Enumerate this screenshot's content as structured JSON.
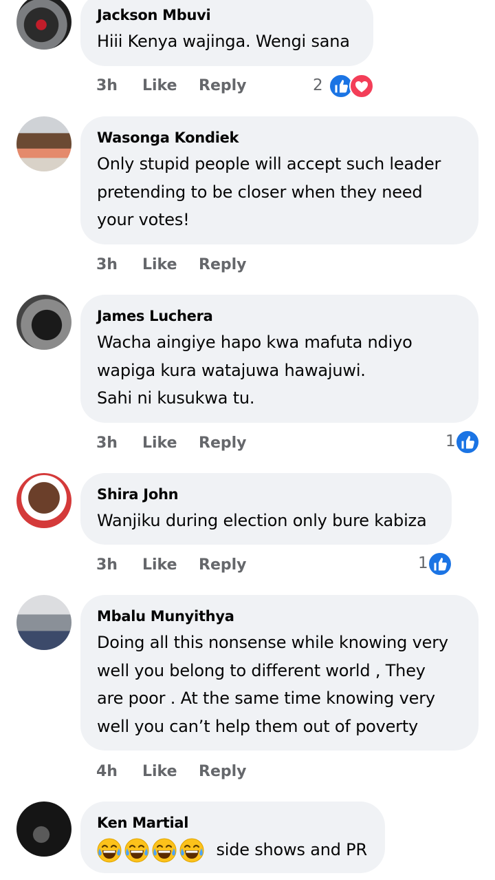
{
  "comments": [
    {
      "author": "Jackson Mbuvi",
      "text": "Hiii Kenya wajinga. Wengi sana",
      "time": "3h",
      "like_label": "Like",
      "reply_label": "Reply",
      "reaction_count": "2",
      "reactions": [
        "like-icon",
        "love-icon"
      ]
    },
    {
      "author": "Wasonga Kondiek",
      "text": "Only stupid people will accept such leader\npretending to be closer when they need\nyour votes!",
      "time": "3h",
      "like_label": "Like",
      "reply_label": "Reply"
    },
    {
      "author": "James Luchera",
      "text": "Wacha aingiye hapo kwa mafuta ndiyo\nwapiga kura watajuwa hawajuwi.\nSahi ni kusukwa tu.",
      "time": "3h",
      "like_label": "Like",
      "reply_label": "Reply",
      "reaction_count": "1",
      "reactions": [
        "like-icon"
      ]
    },
    {
      "author": "Shira John",
      "text": "Wanjiku during election only bure kabiza",
      "time": "3h",
      "like_label": "Like",
      "reply_label": "Reply",
      "reaction_count": "1",
      "reactions": [
        "like-icon"
      ]
    },
    {
      "author": "Mbalu Munyithya",
      "text": "Doing all this nonsense while knowing very\nwell you belong to different world , They\nare poor . At the same time knowing very\nwell you can’t help them out of poverty",
      "time": "4h",
      "like_label": "Like",
      "reply_label": "Reply"
    },
    {
      "author": "Ken Martial",
      "emojis": [
        "laughing-emoji",
        "laughing-emoji",
        "laughing-emoji",
        "laughing-emoji"
      ],
      "text": "side shows and PR"
    }
  ],
  "colors": {
    "bubble": "#f0f2f5",
    "secondary_text": "#65676b",
    "like_blue": "#1b74e4",
    "love_red": "#f33e58"
  }
}
